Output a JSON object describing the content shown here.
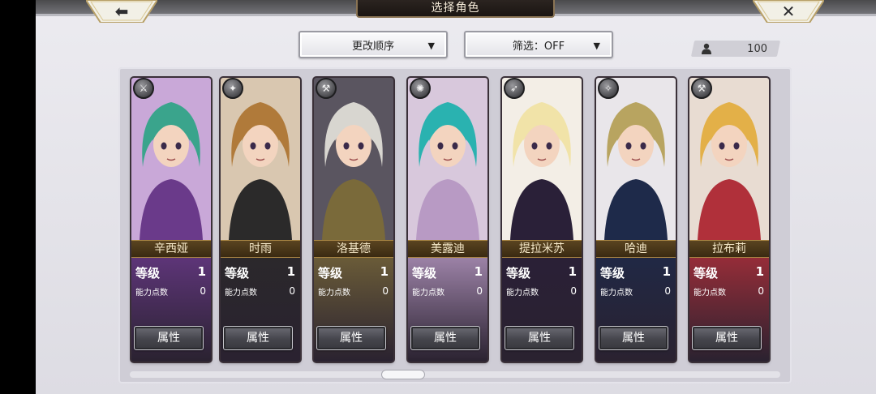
{
  "header": {
    "title": "选择角色",
    "back_icon": "arrow-left-icon",
    "close_icon": "close-x-icon"
  },
  "toolbar": {
    "order_label": "更改顺序",
    "filter_label": "筛选：OFF",
    "count": "100"
  },
  "labels": {
    "level": "等级",
    "points": "能力点数",
    "attr_button": "属性"
  },
  "characters": [
    {
      "name": "辛西娅",
      "level": "1",
      "points": "0",
      "class_icon": "sword-class-icon",
      "hair": "#3aa48c",
      "bg": "#c9a8d8",
      "cloth": "#6a3a8a"
    },
    {
      "name": "时雨",
      "level": "1",
      "points": "0",
      "class_icon": "spear-class-icon",
      "hair": "#b07a3a",
      "bg": "#d9c7b0",
      "cloth": "#2b2a2a"
    },
    {
      "name": "洛基德",
      "level": "1",
      "points": "0",
      "class_icon": "axe-class-icon",
      "hair": "#d8d6d0",
      "bg": "#5a5560",
      "cloth": "#7a6a3a"
    },
    {
      "name": "美露迪",
      "level": "1",
      "points": "0",
      "class_icon": "staff-class-icon",
      "hair": "#2ab2b0",
      "bg": "#d8c8dc",
      "cloth": "#b89ac4"
    },
    {
      "name": "提拉米苏",
      "level": "1",
      "points": "0",
      "class_icon": "bow-class-icon",
      "hair": "#f1e3a8",
      "bg": "#f3eee6",
      "cloth": "#2a2038"
    },
    {
      "name": "哈迪",
      "level": "1",
      "points": "0",
      "class_icon": "gun-class-icon",
      "hair": "#b8a460",
      "bg": "#e9e6ea",
      "cloth": "#1e2a4a"
    },
    {
      "name": "拉布莉",
      "level": "1",
      "points": "0",
      "class_icon": "hammer-class-icon",
      "hair": "#e3b048",
      "bg": "#e8dcd2",
      "cloth": "#b0303a"
    }
  ]
}
